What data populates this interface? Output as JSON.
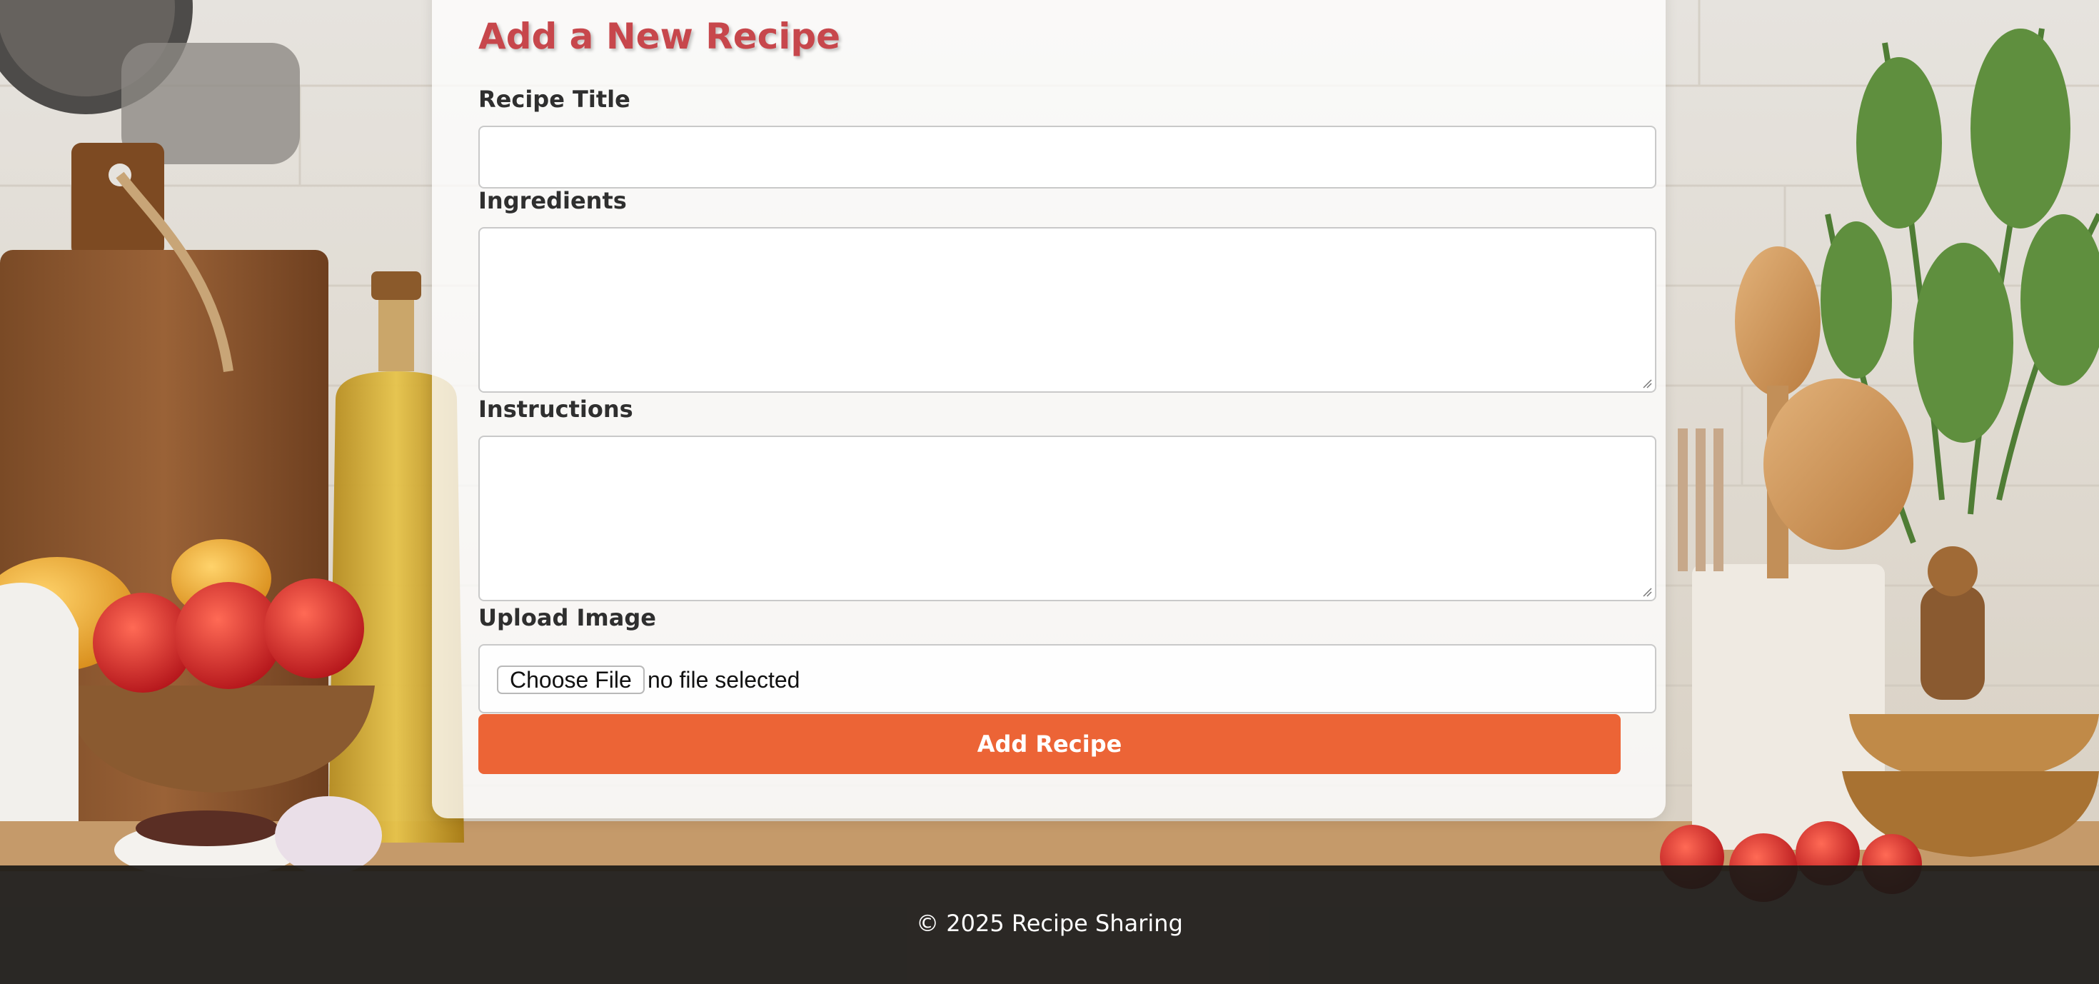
{
  "form": {
    "title": "Add a New Recipe",
    "recipe_title_label": "Recipe Title",
    "recipe_title_value": "",
    "ingredients_label": "Ingredients",
    "ingredients_value": "",
    "instructions_label": "Instructions",
    "instructions_value": "",
    "upload_label": "Upload Image",
    "choose_file_label": "Choose File",
    "file_status": "no file selected",
    "submit_label": "Add Recipe"
  },
  "footer": {
    "text": "© 2025 Recipe Sharing"
  },
  "colors": {
    "heading": "#c7474c",
    "accent_button": "#ec6436",
    "footer_bg": "#1c1a17",
    "card_bg": "#ffffff"
  },
  "icons": {
    "resize_grip": "resize-grip-icon"
  }
}
